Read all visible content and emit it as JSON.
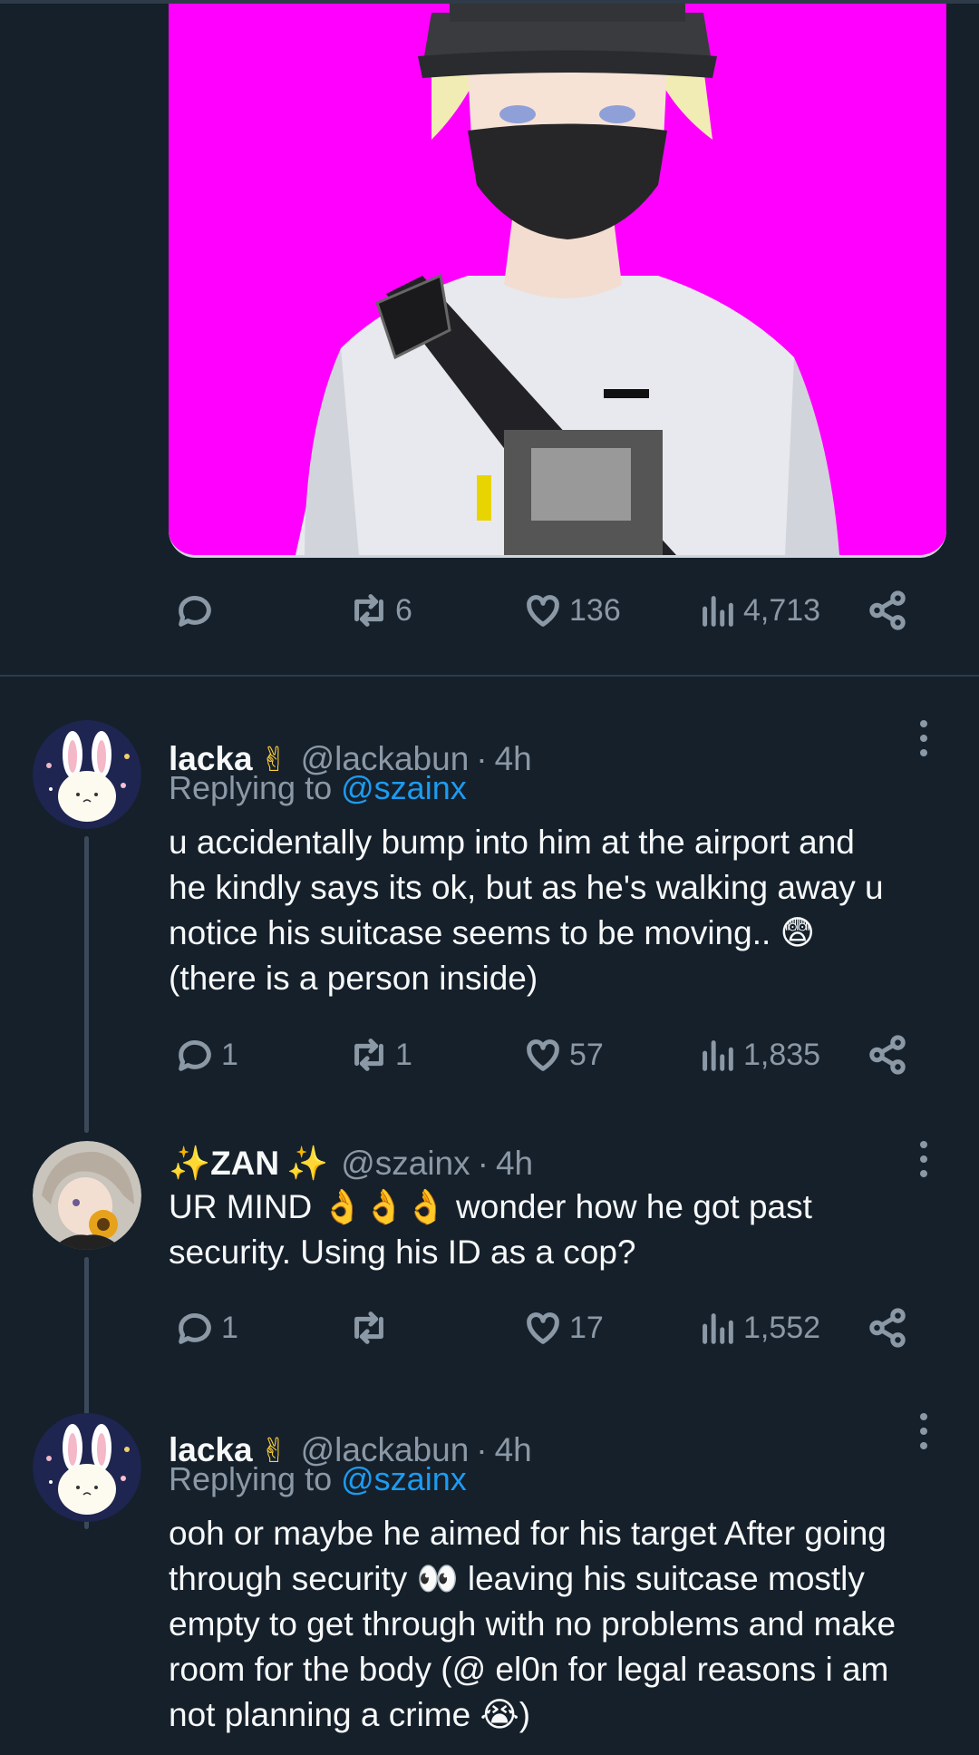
{
  "hero_post": {
    "image_alt": "anime character with cap and mask",
    "actions": {
      "reply": "",
      "retweet": "6",
      "like": "136",
      "views": "4,713"
    }
  },
  "replies": [
    {
      "name": "lacka",
      "name_emoji": "✌",
      "handle": "@lackabun",
      "dot": "·",
      "time": "4h",
      "replying_prefix": "Replying to",
      "replying_to": "@szainx",
      "lines": [
        "u accidentally bump into him at the airport and",
        "he kindly says its ok, but as he's walking away u",
        "notice his suitcase seems to be moving.. 😨",
        "(there is a person inside)"
      ],
      "actions": {
        "reply": "1",
        "retweet": "1",
        "like": "57",
        "views": "1,835"
      }
    },
    {
      "name": "ZAN",
      "name_prefix": "✨",
      "name_suffix": "✨",
      "handle": "@szainx",
      "dot": "·",
      "time": "4h",
      "lines": [
        "UR MIND 👌👌👌 wonder how he got past",
        "security. Using his ID as a cop?"
      ],
      "actions": {
        "reply": "1",
        "retweet": "",
        "like": "17",
        "views": "1,552"
      }
    },
    {
      "name": "lacka",
      "name_emoji": "✌",
      "handle": "@lackabun",
      "dot": "·",
      "time": "4h",
      "replying_prefix": "Replying to",
      "replying_to": "@szainx",
      "lines": [
        "ooh or maybe he aimed for his target After going",
        "through security 👀 leaving his suitcase mostly",
        "empty to get through with no problems and make",
        "room for the body (@ el0n for legal reasons i am",
        "not planning a crime 😭)"
      ]
    }
  ],
  "colors": {
    "background": "#15202b",
    "text": "#f7f9f9",
    "muted": "#8b98a5",
    "accent": "#1d9bf0",
    "hero_bg": "#ff00ff"
  }
}
